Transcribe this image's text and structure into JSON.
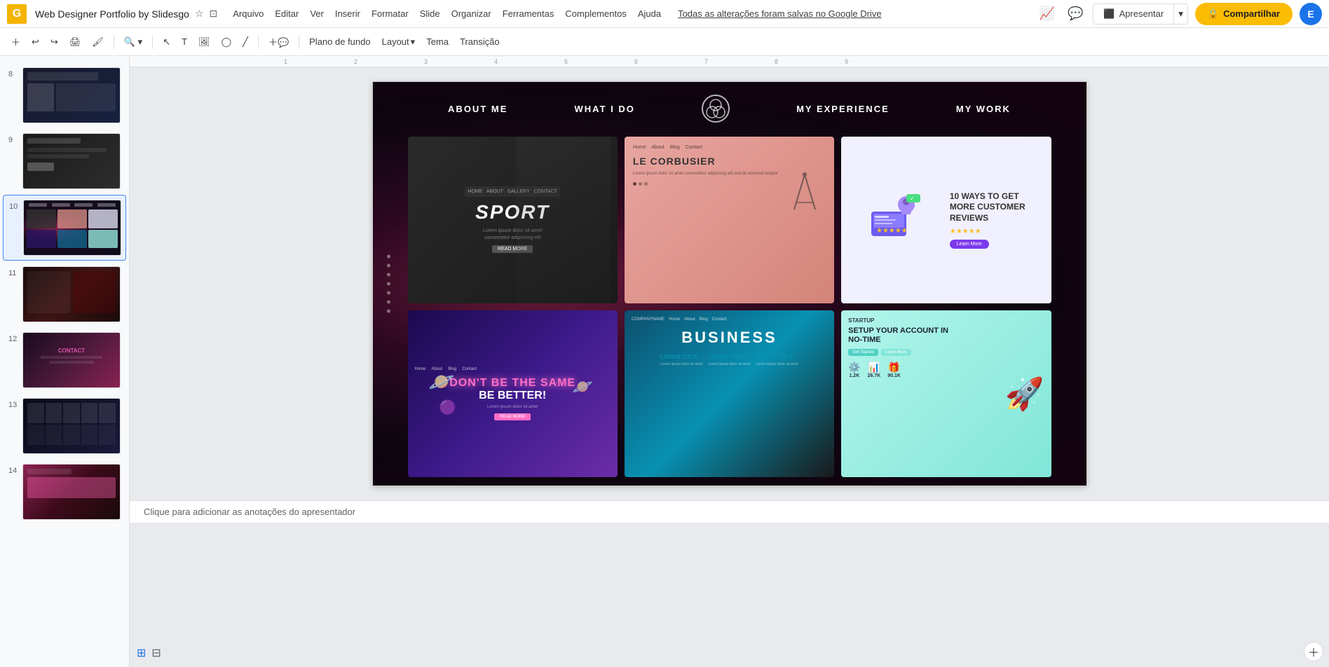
{
  "app": {
    "title": "Web Designer Portfolio by Slidesgo",
    "icon_label": "G",
    "star_icon": "★",
    "folder_icon": "⊡"
  },
  "menu": {
    "items": [
      "Arquivo",
      "Editar",
      "Ver",
      "Inserir",
      "Formatar",
      "Slide",
      "Organizar",
      "Ferramentas",
      "Complementos",
      "Ajuda"
    ]
  },
  "save_status": "Todas as alterações foram salvas no Google Drive",
  "buttons": {
    "present": "Apresentar",
    "share": "Compartilhar",
    "lock_icon": "🔒",
    "avatar": "E"
  },
  "toolbar": {
    "background_btn": "Plano de fundo",
    "layout_btn": "Layout",
    "layout_arrow": "▾",
    "theme_btn": "Tema",
    "transition_btn": "Transição",
    "zoom_icon": "🔍",
    "undo_icon": "↩",
    "redo_icon": "↪"
  },
  "slides": [
    {
      "num": "8",
      "type": "prev-8"
    },
    {
      "num": "9",
      "type": "prev-9"
    },
    {
      "num": "10",
      "type": "prev-10",
      "active": true
    },
    {
      "num": "11",
      "type": "prev-11"
    },
    {
      "num": "12",
      "type": "prev-12"
    },
    {
      "num": "13",
      "type": "prev-13"
    },
    {
      "num": "14",
      "type": "prev-14"
    }
  ],
  "slide_nav": {
    "item1": "ABOUT ME",
    "item2": "WHAT I DO",
    "item3": "MY EXPERIENCE",
    "item4": "MY WORK"
  },
  "portfolio": {
    "sport": {
      "title": "SPORT",
      "read_more": "READ MORE"
    },
    "corbusier": {
      "title": "LE CORBUSIER"
    },
    "reviews": {
      "title": "10 WAYS TO GET MORE CUSTOMER REVIEWS",
      "stars": "★★★★★"
    },
    "space": {
      "line1": "DON'T BE THE SAME",
      "line2": "BE BETTER!",
      "btn": "READ MORE"
    },
    "business": {
      "nav": "COMPANYNAME",
      "title": "BUSINESS"
    },
    "startup": {
      "header": "STARTUP",
      "title": "SETUP YOUR ACCOUNT IN NO-TIME",
      "stat1": "1.2K",
      "stat2": "26.7K",
      "stat3": "90.1K"
    }
  },
  "notes": {
    "placeholder": "Clique para adicionar as anotações do apresentador"
  }
}
